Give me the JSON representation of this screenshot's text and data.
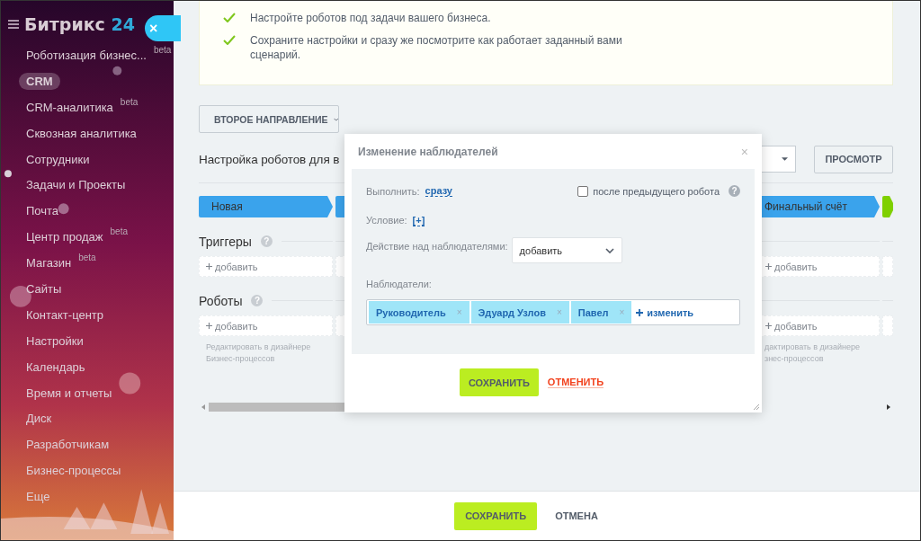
{
  "sidebar": {
    "logo": {
      "name": "Битрикс",
      "number": "24"
    },
    "close": "×",
    "items": [
      {
        "label": "Роботизация бизнес...",
        "badge": "beta",
        "selected": false
      },
      {
        "label": "CRM",
        "selected": true
      },
      {
        "label": "CRM-аналитика",
        "badge": "beta",
        "selected": false
      },
      {
        "label": "Сквозная аналитика",
        "selected": false
      },
      {
        "label": "Сотрудники",
        "selected": false
      },
      {
        "label": "Задачи и Проекты",
        "selected": false
      },
      {
        "label": "Почта",
        "selected": false
      },
      {
        "label": "Центр продаж",
        "badge": "beta",
        "selected": false
      },
      {
        "label": "Магазин",
        "badge": "beta",
        "selected": false
      },
      {
        "label": "Сайты",
        "selected": false
      },
      {
        "label": "Контакт-центр",
        "selected": false
      },
      {
        "label": "Настройки",
        "selected": false
      },
      {
        "label": "Календарь",
        "selected": false
      },
      {
        "label": "Время и отчеты",
        "selected": false
      },
      {
        "label": "Диск",
        "selected": false
      },
      {
        "label": "Разработчикам",
        "selected": false
      },
      {
        "label": "Бизнес-процессы",
        "selected": false
      },
      {
        "label": "Еще",
        "selected": false
      }
    ]
  },
  "tips": [
    "Настройте роботов под задачи вашего бизнеса.",
    "Сохраните настройки и сразу же посмотрите как работает заданный вами сценарий."
  ],
  "direction_button": "ВТОРОЕ НАПРАВЛЕНИЕ",
  "page_title": "Настройка роботов для в",
  "preview_button": "ПРОСМОТР",
  "triggers_heading": "Триггеры",
  "triggers_help": "?",
  "robots_heading": "Роботы",
  "robots_help": "?",
  "columns": [
    {
      "stage": "Новая",
      "color": "#3aa3ec",
      "trigger_add": "добавить",
      "robot_add": "добавить",
      "editor_link": [
        "Редактировать в дизайнере",
        "Бизнес-процессов"
      ],
      "cut_left": false
    },
    {
      "color": "#3aa3ec"
    },
    {
      "stage": "Финальный счёт",
      "color": "#3aa3ec",
      "trigger_add": "добавить",
      "robot_add": "добавить",
      "editor_link": [
        "дактировать в дизайнере",
        "знес-процессов"
      ],
      "cut_left": true
    },
    {
      "color": "#7fd000"
    }
  ],
  "dialog": {
    "title": "Изменение наблюдателей",
    "close": "×",
    "run_label": "Выполнить:",
    "run_value": "сразу",
    "after_previous": {
      "label": "после предыдущего робота",
      "checked": false,
      "help": "?"
    },
    "condition_label": "Условие:",
    "condition_value": "[+]",
    "action_label": "Действие над наблюдателями:",
    "action_value": "добавить",
    "observers_label": "Наблюдатели:",
    "observers": [
      {
        "name": "Руководитель",
        "remove": "×"
      },
      {
        "name": "Эдуард Узлов",
        "remove": "×"
      },
      {
        "name": "Павел",
        "remove": "×"
      }
    ],
    "change_link": "изменить",
    "save": "СОХРАНИТЬ",
    "cancel": "ОТМЕНИТЬ"
  },
  "footer": {
    "save": "СОХРАНИТЬ",
    "cancel": "ОТМЕНА"
  }
}
